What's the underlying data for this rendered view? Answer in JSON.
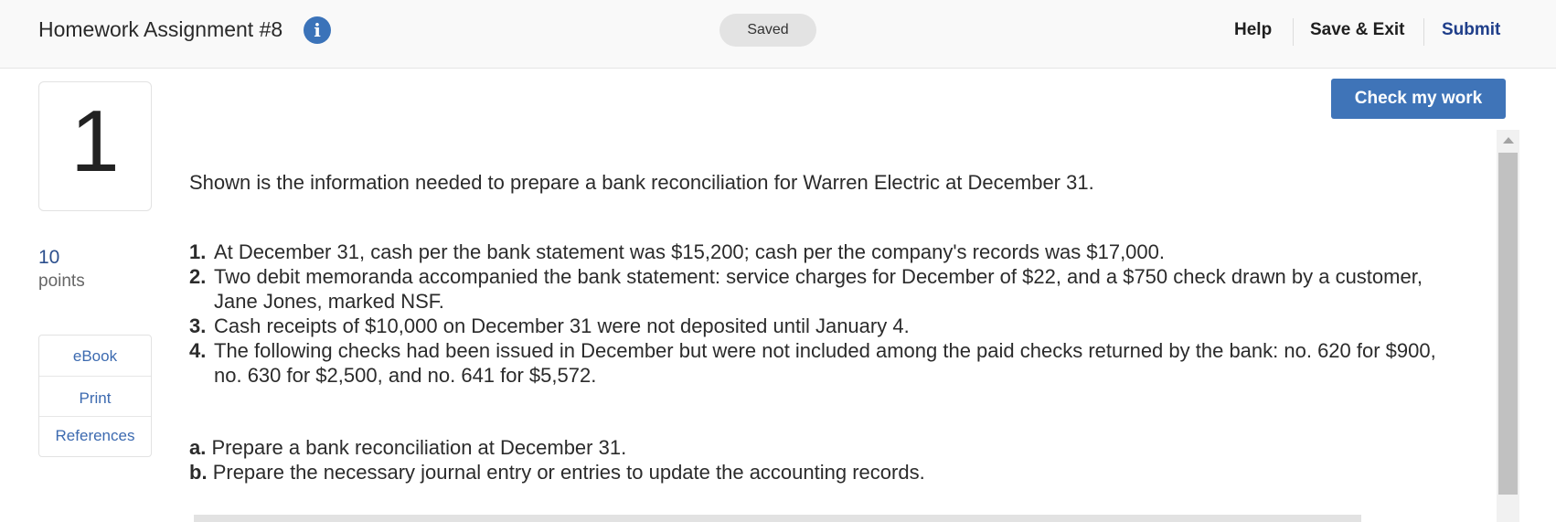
{
  "header": {
    "title": "Homework Assignment #8",
    "info_icon": "i",
    "saved_label": "Saved",
    "help_label": "Help",
    "save_exit_label": "Save & Exit",
    "submit_label": "Submit"
  },
  "question": {
    "number": "1",
    "points_value": "10",
    "points_label": "points",
    "tools": [
      "eBook",
      "Print",
      "References"
    ],
    "check_label": "Check my work",
    "intro": "Shown is the information needed to prepare a bank reconciliation for Warren Electric at December 31.",
    "items": [
      {
        "num": "1.",
        "text": "At December 31, cash per the bank statement was $15,200; cash per the company's records was $17,000."
      },
      {
        "num": "2.",
        "text": "Two debit memoranda accompanied the bank statement: service charges for December of $22, and a $750 check drawn by a customer, Jane Jones, marked NSF."
      },
      {
        "num": "3.",
        "text": "Cash receipts of $10,000 on December 31 were not deposited until January 4."
      },
      {
        "num": "4.",
        "text": "The following checks had been issued in December but were not included among the paid checks returned by the bank: no. 620 for $900, no. 630 for $2,500, and no. 641 for $5,572."
      }
    ],
    "parts": [
      {
        "label": "a.",
        "text": "Prepare a bank reconciliation at December 31."
      },
      {
        "label": "b.",
        "text": "Prepare the necessary journal entry or entries to update the accounting records."
      }
    ]
  },
  "colors": {
    "accent": "#3f74b8",
    "submit": "#1f3e8a",
    "link": "#3c6ab0"
  }
}
